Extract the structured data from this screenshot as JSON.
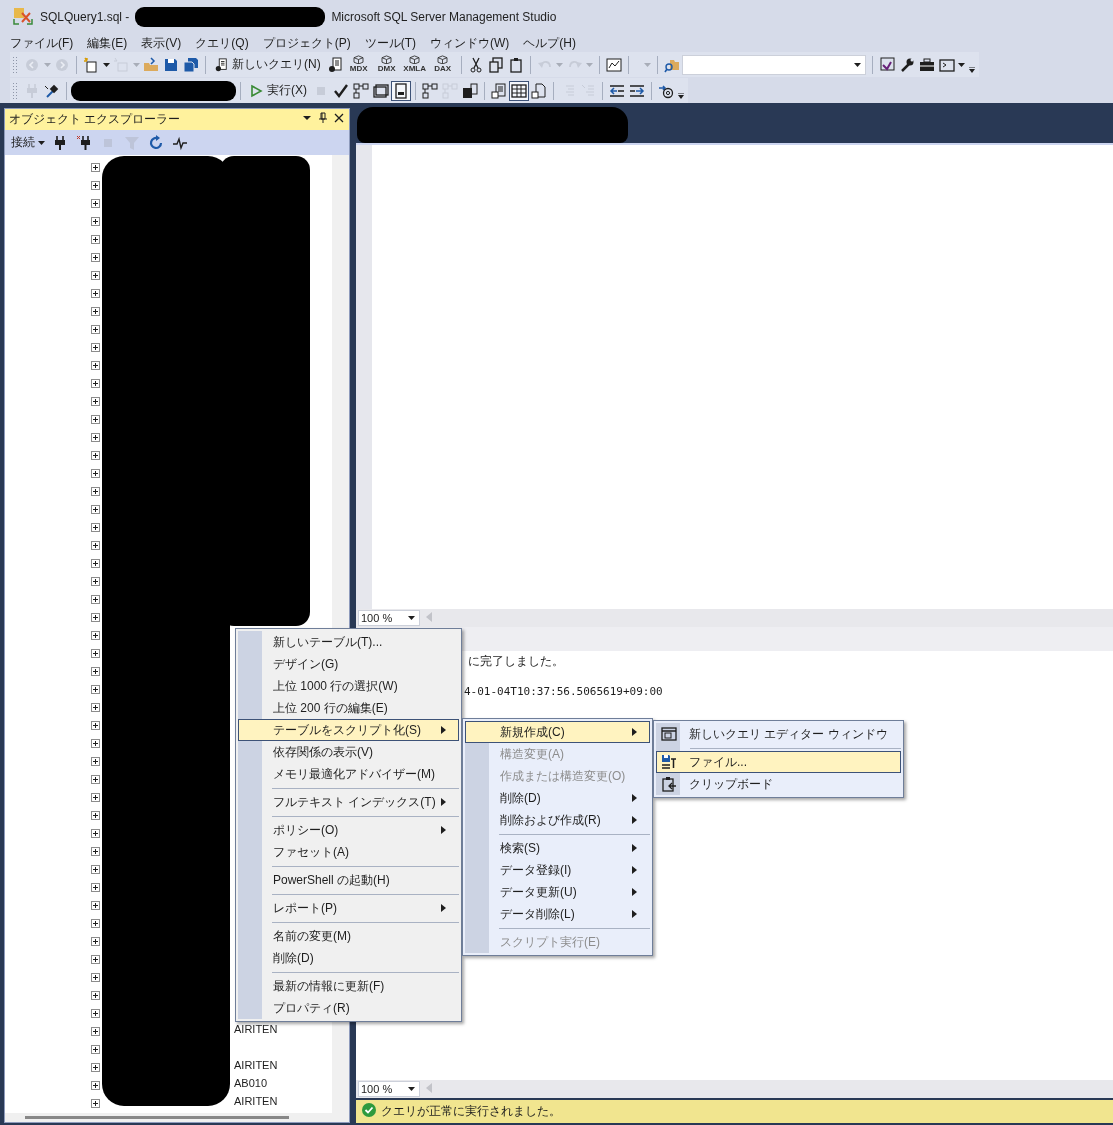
{
  "window": {
    "title_prefix": "SQLQuery1.sql -",
    "title_suffix": "Microsoft SQL Server Management Studio"
  },
  "menu_bar": [
    "ファイル(F)",
    "編集(E)",
    "表示(V)",
    "クエリ(Q)",
    "プロジェクト(P)",
    "ツール(T)",
    "ウィンドウ(W)",
    "ヘルプ(H)"
  ],
  "toolbar_1": [
    {
      "kind": "back",
      "disabled": true
    },
    {
      "kind": "caret",
      "disabled": true
    },
    {
      "kind": "forward",
      "disabled": true
    },
    {
      "kind": "sep"
    },
    {
      "kind": "new-project",
      "disabled": false
    },
    {
      "kind": "caret",
      "disabled": false
    },
    {
      "kind": "add-item",
      "disabled": true
    },
    {
      "kind": "caret",
      "disabled": true
    },
    {
      "kind": "open",
      "disabled": false
    },
    {
      "kind": "save",
      "disabled": false
    },
    {
      "kind": "save-all",
      "disabled": false
    },
    {
      "kind": "sep"
    },
    {
      "kind": "text-button",
      "label": "新しいクエリ(N)",
      "disabled": false
    },
    {
      "kind": "db-query",
      "disabled": false
    },
    {
      "kind": "cube",
      "label": "MDX",
      "disabled": false
    },
    {
      "kind": "cube",
      "label": "DMX",
      "disabled": false
    },
    {
      "kind": "cube",
      "label": "XMLA",
      "disabled": false
    },
    {
      "kind": "cube",
      "label": "DAX",
      "disabled": false
    },
    {
      "kind": "sep"
    },
    {
      "kind": "cut",
      "disabled": false
    },
    {
      "kind": "copy",
      "disabled": false
    },
    {
      "kind": "paste",
      "disabled": false
    },
    {
      "kind": "sep"
    },
    {
      "kind": "undo",
      "disabled": true
    },
    {
      "kind": "caret",
      "disabled": true
    },
    {
      "kind": "redo",
      "disabled": true
    },
    {
      "kind": "caret",
      "disabled": true
    },
    {
      "kind": "sep"
    },
    {
      "kind": "monitor",
      "disabled": false
    },
    {
      "kind": "sep"
    },
    {
      "kind": "spacer"
    },
    {
      "kind": "caret",
      "disabled": true
    },
    {
      "kind": "sep"
    },
    {
      "kind": "find-files",
      "disabled": false
    },
    {
      "kind": "combo",
      "disabled": false
    },
    {
      "kind": "sep"
    },
    {
      "kind": "vs",
      "disabled": false
    },
    {
      "kind": "wrench",
      "disabled": false
    },
    {
      "kind": "toolbox",
      "disabled": false
    },
    {
      "kind": "terminal",
      "disabled": false
    },
    {
      "kind": "caret",
      "disabled": false
    },
    {
      "kind": "overflow"
    }
  ],
  "toolbar_2": [
    {
      "kind": "plug",
      "disabled": true
    },
    {
      "kind": "change-connection",
      "disabled": false
    },
    {
      "kind": "sep"
    },
    {
      "kind": "db-combo",
      "disabled": false
    },
    {
      "kind": "sep"
    },
    {
      "kind": "run",
      "label": "実行(X)",
      "disabled": false
    },
    {
      "kind": "stop",
      "disabled": true
    },
    {
      "kind": "check",
      "disabled": false
    },
    {
      "kind": "plan",
      "disabled": false
    },
    {
      "kind": "window",
      "disabled": false
    },
    {
      "kind": "calc",
      "disabled": false,
      "selected": true
    },
    {
      "kind": "sep"
    },
    {
      "kind": "plan",
      "disabled": false
    },
    {
      "kind": "plan",
      "disabled": true
    },
    {
      "kind": "stats",
      "disabled": false
    },
    {
      "kind": "sep"
    },
    {
      "kind": "text-results",
      "disabled": false,
      "selected": false
    },
    {
      "kind": "grid-results",
      "disabled": false,
      "selected": true
    },
    {
      "kind": "file-results",
      "disabled": false,
      "selected": false
    },
    {
      "kind": "sep"
    },
    {
      "kind": "comment",
      "disabled": true
    },
    {
      "kind": "uncomment",
      "disabled": true
    },
    {
      "kind": "sep"
    },
    {
      "kind": "outdent",
      "disabled": false
    },
    {
      "kind": "indent",
      "disabled": false
    },
    {
      "kind": "sep"
    },
    {
      "kind": "template",
      "disabled": false
    },
    {
      "kind": "overflow"
    }
  ],
  "object_explorer": {
    "title": "オブジェクト エクスプローラー",
    "connect_label": "接続",
    "toolbar": [
      {
        "kind": "plug",
        "disabled": false
      },
      {
        "kind": "disconnect",
        "disabled": false
      },
      {
        "kind": "stop",
        "disabled": true
      },
      {
        "kind": "filter",
        "disabled": true
      },
      {
        "kind": "refresh",
        "disabled": false
      },
      {
        "kind": "activity",
        "disabled": false
      }
    ],
    "tree": [
      {
        "expanded": false
      },
      {
        "expanded": false
      },
      {
        "expanded": false
      },
      {
        "expanded": false
      },
      {
        "expanded": false
      },
      {
        "expanded": false
      },
      {
        "expanded": false
      },
      {
        "expanded": false
      },
      {
        "expanded": false
      },
      {
        "expanded": false
      },
      {
        "expanded": false
      },
      {
        "expanded": false
      },
      {
        "expanded": false
      },
      {
        "expanded": false
      },
      {
        "expanded": false
      },
      {
        "expanded": false
      },
      {
        "expanded": false
      },
      {
        "expanded": false
      },
      {
        "expanded": false
      },
      {
        "expanded": false
      },
      {
        "expanded": false
      },
      {
        "expanded": false
      },
      {
        "expanded": false
      },
      {
        "expanded": false
      },
      {
        "expanded": false
      },
      {
        "expanded": false
      },
      {
        "expanded": false
      },
      {
        "expanded": false
      },
      {
        "expanded": false
      },
      {
        "expanded": false
      },
      {
        "expanded": false
      },
      {
        "expanded": false
      },
      {
        "expanded": false
      },
      {
        "expanded": false
      },
      {
        "expanded": false
      },
      {
        "expanded": false
      },
      {
        "expanded": false
      },
      {
        "expanded": false
      },
      {
        "expanded": false
      },
      {
        "expanded": false
      },
      {
        "expanded": false
      },
      {
        "expanded": false
      },
      {
        "expanded": false
      },
      {
        "expanded": false
      },
      {
        "expanded": false
      },
      {
        "expanded": false
      },
      {
        "expanded": false
      },
      {
        "expanded": false
      },
      {
        "expanded": false,
        "label": "AIRITEN"
      },
      {
        "expanded": false
      },
      {
        "expanded": false,
        "label": "AIRITEN"
      },
      {
        "expanded": false,
        "label": "AB010"
      },
      {
        "expanded": false,
        "label": "AIRITEN"
      }
    ]
  },
  "editor": {
    "zoom": "100 %"
  },
  "results": {
    "lines": [
      "に完了しました。",
      "4-01-04T10:37:56.5065619+09:00"
    ],
    "zoom": "100 %"
  },
  "status_bar": {
    "message": "クエリが正常に実行されました。"
  },
  "context_menu": [
    {
      "kind": "item",
      "label": "新しいテーブル(T)...",
      "submenu": false,
      "selected": false,
      "disabled": false
    },
    {
      "kind": "item",
      "label": "デザイン(G)",
      "submenu": false,
      "selected": false,
      "disabled": false
    },
    {
      "kind": "item",
      "label": "上位 1000 行の選択(W)",
      "submenu": false,
      "selected": false,
      "disabled": false
    },
    {
      "kind": "item",
      "label": "上位 200 行の編集(E)",
      "submenu": false,
      "selected": false,
      "disabled": false
    },
    {
      "kind": "item",
      "label": "テーブルをスクリプト化(S)",
      "submenu": true,
      "selected": true,
      "disabled": false
    },
    {
      "kind": "item",
      "label": "依存関係の表示(V)",
      "submenu": false,
      "selected": false,
      "disabled": false
    },
    {
      "kind": "item",
      "label": "メモリ最適化アドバイザー(M)",
      "submenu": false,
      "selected": false,
      "disabled": false
    },
    {
      "kind": "separator"
    },
    {
      "kind": "item",
      "label": "フルテキスト インデックス(T)",
      "submenu": true,
      "selected": false,
      "disabled": false
    },
    {
      "kind": "separator"
    },
    {
      "kind": "item",
      "label": "ポリシー(O)",
      "submenu": true,
      "selected": false,
      "disabled": false
    },
    {
      "kind": "item",
      "label": "ファセット(A)",
      "submenu": false,
      "selected": false,
      "disabled": false
    },
    {
      "kind": "separator"
    },
    {
      "kind": "item",
      "label": "PowerShell の起動(H)",
      "submenu": false,
      "selected": false,
      "disabled": false
    },
    {
      "kind": "separator"
    },
    {
      "kind": "item",
      "label": "レポート(P)",
      "submenu": true,
      "selected": false,
      "disabled": false
    },
    {
      "kind": "separator"
    },
    {
      "kind": "item",
      "label": "名前の変更(M)",
      "submenu": false,
      "selected": false,
      "disabled": false
    },
    {
      "kind": "item",
      "label": "削除(D)",
      "submenu": false,
      "selected": false,
      "disabled": false
    },
    {
      "kind": "separator"
    },
    {
      "kind": "item",
      "label": "最新の情報に更新(F)",
      "submenu": false,
      "selected": false,
      "disabled": false
    },
    {
      "kind": "item",
      "label": "プロパティ(R)",
      "submenu": false,
      "selected": false,
      "disabled": false
    }
  ],
  "script_submenu": [
    {
      "kind": "item",
      "label": "新規作成(C)",
      "submenu": true,
      "selected": true,
      "disabled": false
    },
    {
      "kind": "item",
      "label": "構造変更(A)",
      "submenu": false,
      "selected": false,
      "disabled": true
    },
    {
      "kind": "item",
      "label": "作成または構造変更(O)",
      "submenu": false,
      "selected": false,
      "disabled": true
    },
    {
      "kind": "item",
      "label": "削除(D)",
      "submenu": true,
      "selected": false,
      "disabled": false
    },
    {
      "kind": "item",
      "label": "削除および作成(R)",
      "submenu": true,
      "selected": false,
      "disabled": false
    },
    {
      "kind": "separator"
    },
    {
      "kind": "item",
      "label": "検索(S)",
      "submenu": true,
      "selected": false,
      "disabled": false
    },
    {
      "kind": "item",
      "label": "データ登録(I)",
      "submenu": true,
      "selected": false,
      "disabled": false
    },
    {
      "kind": "item",
      "label": "データ更新(U)",
      "submenu": true,
      "selected": false,
      "disabled": false
    },
    {
      "kind": "item",
      "label": "データ削除(L)",
      "submenu": true,
      "selected": false,
      "disabled": false
    },
    {
      "kind": "separator"
    },
    {
      "kind": "item",
      "label": "スクリプト実行(E)",
      "submenu": false,
      "selected": false,
      "disabled": true
    }
  ],
  "create_submenu": [
    {
      "kind": "item",
      "label": "新しいクエリ エディター ウィンドウ",
      "submenu": false,
      "selected": false,
      "disabled": false
    },
    {
      "kind": "separator"
    },
    {
      "kind": "item",
      "label": "ファイル...",
      "submenu": false,
      "selected": true,
      "disabled": false
    },
    {
      "kind": "item",
      "label": "クリップボード",
      "submenu": false,
      "selected": false,
      "disabled": false
    }
  ]
}
